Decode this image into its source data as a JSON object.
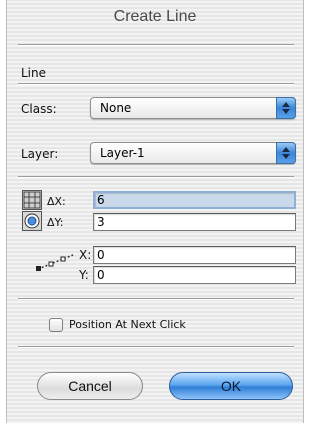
{
  "window": {
    "title": "Create Line"
  },
  "section": {
    "title": "Line"
  },
  "class_row": {
    "label": "Class:",
    "value": "None"
  },
  "layer_row": {
    "label": "Layer:",
    "value": "Layer-1"
  },
  "delta": {
    "dx_label": "ΔX:",
    "dx_value": "6",
    "dy_label": "ΔY:",
    "dy_value": "3"
  },
  "position": {
    "x_label": "X:",
    "x_value": "0",
    "y_label": "Y:",
    "y_value": "0"
  },
  "options": {
    "position_at_next_click": "Position At Next Click",
    "checked": false
  },
  "buttons": {
    "cancel": "Cancel",
    "ok": "OK"
  },
  "colors": {
    "accent": "#3b86d8",
    "focus": "#c9d9ea"
  },
  "icons": {
    "grid": "grid-icon",
    "radio_target": "target-icon",
    "line_points": "line-points-icon"
  }
}
